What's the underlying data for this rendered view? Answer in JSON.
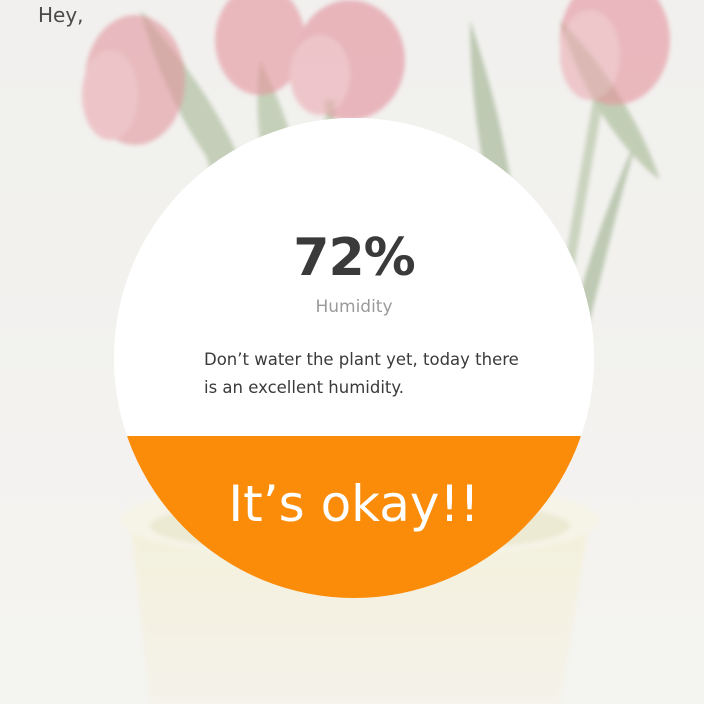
{
  "header": {
    "greeting": "Hey,"
  },
  "humidity_card": {
    "value": "72%",
    "label": "Humidity",
    "message": "Don’t water the plant yet, today there is an excellent humidity.",
    "status": "It’s okay!!",
    "status_color": "#fb8c09"
  },
  "background": {
    "image": "tulips-in-pot-photo"
  }
}
